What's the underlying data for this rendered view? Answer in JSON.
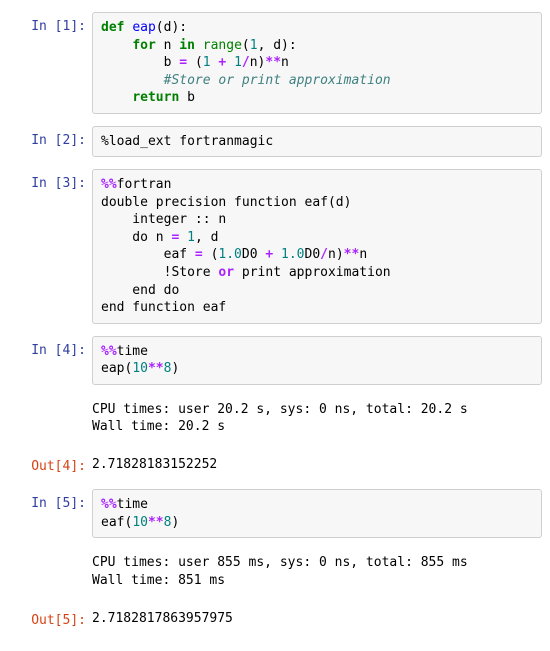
{
  "cells": {
    "c1": {
      "prompt": "In [1]:",
      "code": {
        "l1": {
          "def": "def ",
          "name": "eap",
          "rest": "(d):"
        },
        "l2": {
          "indent": "    ",
          "for": "for ",
          "n": "n ",
          "in": "in ",
          "range": "range",
          "op1": "(",
          "num1": "1",
          "comma": ", d):"
        },
        "l3": {
          "indent": "        ",
          "b": "b ",
          "eq": "= ",
          "op2": "(",
          "num1": "1",
          "sp1": " ",
          "plus": "+",
          "sp2": " ",
          "num2": "1",
          "slash": "/",
          "n2": "n)",
          "pow": "**",
          "n3": "n"
        },
        "l4": {
          "indent": "        ",
          "cm": "#Store or print approximation"
        },
        "l5": {
          "indent": "    ",
          "ret": "return ",
          "b": "b"
        }
      }
    },
    "c2": {
      "prompt": "In [2]:",
      "text": "%load_ext fortranmagic"
    },
    "c3": {
      "prompt": "In [3]:",
      "lines": {
        "l1a": "%%",
        "l1b": "fortran",
        "l2": "double precision function eaf(d)",
        "l3": "    integer :: n",
        "l4a": "    do n ",
        "l4eq": "=",
        "l4b": " ",
        "l4n1": "1",
        "l4c": ", d",
        "l5a": "        eaf ",
        "l5eq": "=",
        "l5b": " (",
        "l5n1": "1.0",
        "l5d0": "D0 ",
        "l5plus": "+",
        "l5sp": " ",
        "l5n2": "1.0",
        "l5d02": "D0",
        "l5slash": "/",
        "l5n": "n)",
        "l5pow": "**",
        "l5nn": "n",
        "l6a": "        !Store ",
        "l6or": "or",
        "l6b": " print approximation",
        "l7": "    end do",
        "l8": "end function eaf"
      }
    },
    "c4": {
      "prompt_in": "In [4]:",
      "prompt_out": "Out[4]:",
      "in": {
        "l1": "%%time",
        "l2a": "eap(",
        "l2n": "10",
        "l2pow": "**",
        "l2n2": "8",
        "l2b": ")"
      },
      "stdout": "CPU times: user 20.2 s, sys: 0 ns, total: 20.2 s\nWall time: 20.2 s",
      "out": "2.71828183152252"
    },
    "c5": {
      "prompt_in": "In [5]:",
      "prompt_out": "Out[5]:",
      "in": {
        "l1": "%%time",
        "l2a": "eaf(",
        "l2n": "10",
        "l2pow": "**",
        "l2n2": "8",
        "l2b": ")"
      },
      "stdout": "CPU times: user 855 ms, sys: 0 ns, total: 855 ms\nWall time: 851 ms",
      "out": "2.7182817863957975"
    }
  }
}
